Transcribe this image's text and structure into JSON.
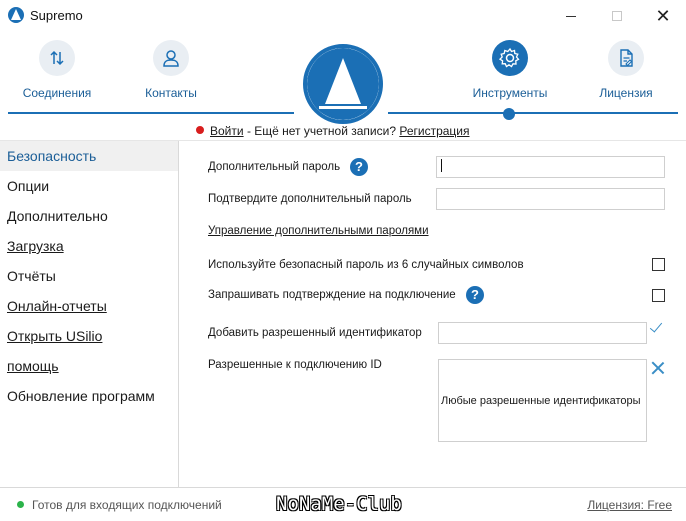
{
  "window": {
    "title": "Supremo",
    "icon": "supremo-logo-icon"
  },
  "nav": {
    "connections": "Соединения",
    "contacts": "Контакты",
    "tools": "Инструменты",
    "license": "Лицензия",
    "active": "tools"
  },
  "login_bar": {
    "login_link": "Войти",
    "no_account_text": "- Ещё нет учетной записи?",
    "register_link": "Регистрация"
  },
  "sidebar": {
    "items": [
      {
        "label": "Безопасность"
      },
      {
        "label": "Опции"
      },
      {
        "label": "Дополнительно"
      },
      {
        "label": "Загрузка"
      },
      {
        "label": "Отчёты"
      },
      {
        "label": "Онлайн-отчеты"
      },
      {
        "label": "Открыть USilio"
      },
      {
        "label": "помощь"
      },
      {
        "label": "Обновление программ"
      }
    ],
    "active_index": 0
  },
  "form": {
    "extra_password_label": "Дополнительный пароль",
    "confirm_password_label": "Подтвердите дополнительный пароль",
    "manage_passwords_link": "Управление дополнительными паролями",
    "secure_password_label": "Используйте безопасный пароль из 6 случайных символов",
    "ask_confirmation_label": "Запрашивать подтверждение на подключение",
    "add_id_label": "Добавить разрешенный идентификатор",
    "allowed_ids_label": "Разрешенные к подключению ID",
    "allowed_ids_value": "Любые разрешенные идентификаторы",
    "secure_password_checked": false,
    "ask_confirmation_checked": false,
    "help_glyph": "?"
  },
  "status": {
    "text": "Готов для входящих подключений",
    "license": "Лицензия: Free",
    "watermark": "NoNaMe-Club"
  },
  "colors": {
    "accent": "#1b6fb5",
    "status_ok": "#2bb34a",
    "login_dot": "#d81e1e"
  }
}
